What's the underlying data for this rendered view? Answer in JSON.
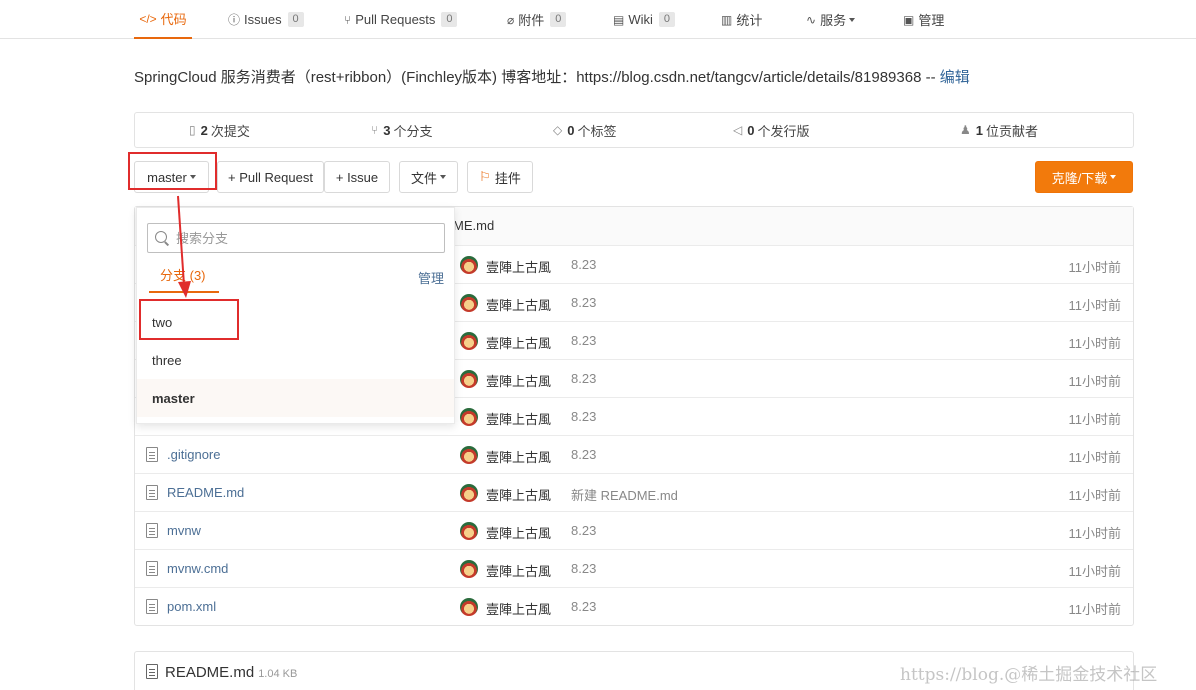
{
  "topnav": {
    "tabs": [
      {
        "label": "代码",
        "icon": "code-icon",
        "count": null,
        "active": true
      },
      {
        "label": "Issues",
        "icon": "issue-icon",
        "count": "0"
      },
      {
        "label": "Pull Requests",
        "icon": "pull-request-icon",
        "count": "0"
      },
      {
        "label": "附件",
        "icon": "attachment-icon",
        "count": "0"
      },
      {
        "label": "Wiki",
        "icon": "wiki-icon",
        "count": "0"
      },
      {
        "label": "统计",
        "icon": "stats-icon",
        "count": null
      },
      {
        "label": "服务",
        "icon": "service-icon",
        "count": null
      },
      {
        "label": "管理",
        "icon": "manage-icon",
        "count": null
      }
    ]
  },
  "repo": {
    "description": "SpringCloud 服务消费者（rest+ribbon）(Finchley版本) 博客地址：https://blog.csdn.net/tangcv/article/details/81989368 --",
    "edit_label": "编辑"
  },
  "stats": {
    "commits": {
      "count": "2",
      "label": "次提交"
    },
    "branches": {
      "count": "3",
      "label": "个分支"
    },
    "tags": {
      "count": "0",
      "label": "个标签"
    },
    "releases": {
      "count": "0",
      "label": "个发行版"
    },
    "contributors": {
      "count": "1",
      "label": "位贡献者"
    }
  },
  "toolbar": {
    "branch": "master",
    "pull_request": "+ Pull Request",
    "issue": "+ Issue",
    "file": "文件",
    "widget": "挂件",
    "clone": "克隆/下载"
  },
  "branch_dropdown": {
    "search_placeholder": "搜索分支",
    "tab_label": "分支 (3)",
    "manage_label": "管理",
    "branches": [
      "two",
      "three",
      "master"
    ],
    "current": "master"
  },
  "files": {
    "header_name": "README.md",
    "header_name_visible": "ME.md",
    "rows": [
      {
        "name": "",
        "author": "壹陣上古風",
        "message": "8.23",
        "time": "11小时前"
      },
      {
        "name": "",
        "author": "壹陣上古風",
        "message": "8.23",
        "time": "11小时前"
      },
      {
        "name": "",
        "author": "壹陣上古風",
        "message": "8.23",
        "time": "11小时前"
      },
      {
        "name": "",
        "author": "壹陣上古風",
        "message": "8.23",
        "time": "11小时前"
      },
      {
        "name": "",
        "author": "壹陣上古風",
        "message": "8.23",
        "time": "11小时前"
      },
      {
        "name": ".gitignore",
        "author": "壹陣上古風",
        "message": "8.23",
        "time": "11小时前"
      },
      {
        "name": "README.md",
        "author": "壹陣上古風",
        "message": "新建 README.md",
        "time": "11小时前"
      },
      {
        "name": "mvnw",
        "author": "壹陣上古風",
        "message": "8.23",
        "time": "11小时前"
      },
      {
        "name": "mvnw.cmd",
        "author": "壹陣上古風",
        "message": "8.23",
        "time": "11小时前"
      },
      {
        "name": "pom.xml",
        "author": "壹陣上古風",
        "message": "8.23",
        "time": "11小时前"
      }
    ]
  },
  "readme": {
    "title": "README.md",
    "size": "1.04 KB"
  },
  "watermark": "https://blog.@稀土掘金技术社区",
  "colors": {
    "accent": "#e8680d",
    "clone_button": "#f27a0c",
    "annotation_red": "#e02c2c",
    "link": "#4c6f95"
  }
}
